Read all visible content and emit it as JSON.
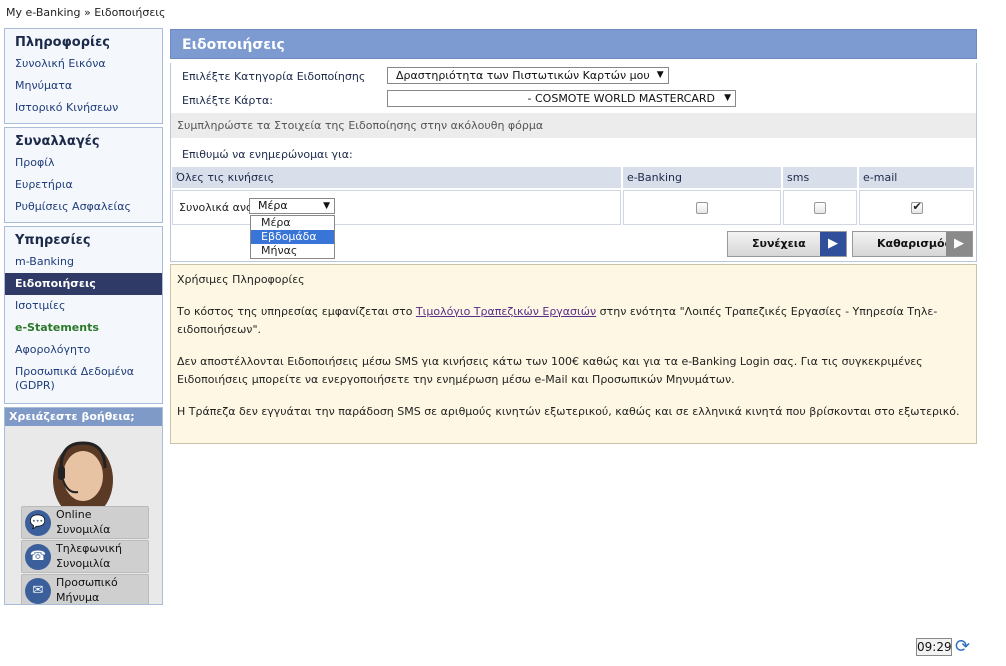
{
  "breadcrumb": "My e-Banking » Ειδοποιήσεις",
  "sidebar": {
    "groups": [
      {
        "title": "Πληροφορίες",
        "items": [
          "Συνολική Εικόνα",
          "Μηνύματα",
          "Ιστορικό Κινήσεων"
        ]
      },
      {
        "title": "Συναλλαγές",
        "items": [
          "Προφίλ",
          "Ευρετήρια",
          "Ρυθμίσεις Ασφαλείας"
        ]
      },
      {
        "title": "Υπηρεσίες",
        "items": [
          "m-Banking",
          "Ειδοποιήσεις",
          "Ισοτιμίες",
          "e-Statements",
          "Αφορολόγητο",
          "Προσωπικά Δεδομένα (GDPR)"
        ]
      }
    ],
    "active_item": "Ειδοποιήσεις",
    "help": {
      "title": "Χρειάζεστε βοήθεια;",
      "buttons": [
        "Online Συνομιλία",
        "Τηλεφωνική Συνομιλία",
        "Προσωπικό Μήνυμα"
      ]
    }
  },
  "main": {
    "title": "Ειδοποιήσεις",
    "category_label": "Επιλέξτε Κατηγορία Ειδοποίησης",
    "category_value": "Δραστηριότητα των Πιστωτικών Καρτών μου",
    "card_label": "Επιλέξτε Κάρτα:",
    "card_value": "- COSMOTE WORLD MASTERCARD",
    "form_band": "Συμπληρώστε τα Στοιχεία της Ειδοποίησης στην ακόλουθη φόρμα",
    "notify_label": "Επιθυμώ να ενημερώνομαι για:",
    "table": {
      "headers": [
        "Όλες τις κινήσεις",
        "e-Banking",
        "sms",
        "e-mail"
      ],
      "row_label": "Συνολικά ανά",
      "period_value": "Μέρα",
      "period_options": [
        "Μέρα",
        "Εβδομάδα",
        "Μήνας"
      ],
      "period_highlighted": "Εβδομάδα",
      "ebanking_checked": false,
      "sms_checked": false,
      "email_checked": true
    },
    "continue_label": "Συνέχεια",
    "clear_label": "Καθαρισμός",
    "info": {
      "title": "Χρήσιμες Πληροφορίες",
      "p1_before": "Το κόστος της υπηρεσίας εμφανίζεται στο ",
      "p1_link": "Τιμολόγιο Τραπεζικών Εργασιών",
      "p1_after": " στην ενότητα \"Λοιπές Τραπεζικές Εργασίες - Υπηρεσία Τηλε-ειδοποιήσεων\".",
      "p2": "Δεν αποστέλλονται Ειδοποιήσεις μέσω SMS για κινήσεις κάτω των 100€ καθώς και για τα e-Banking Login σας. Για τις συγκεκριμένες Ειδοποιήσεις μπορείτε να ενεργοποιήσετε την ενημέρωση μέσω e-Mail και Προσωπικών Μηνυμάτων.",
      "p3": "Η Τράπεζα δεν εγγυάται την παράδοση SMS σε αριθμούς κινητών εξωτερικού, καθώς και σε ελληνικά κινητά που βρίσκονται στο εξωτερικό."
    }
  },
  "clock": "09:29",
  "colors": {
    "header": "#7d9bd0",
    "active": "#2f3b66",
    "info_bg": "#fdf7e3",
    "arrow": "#2f4f9a"
  }
}
